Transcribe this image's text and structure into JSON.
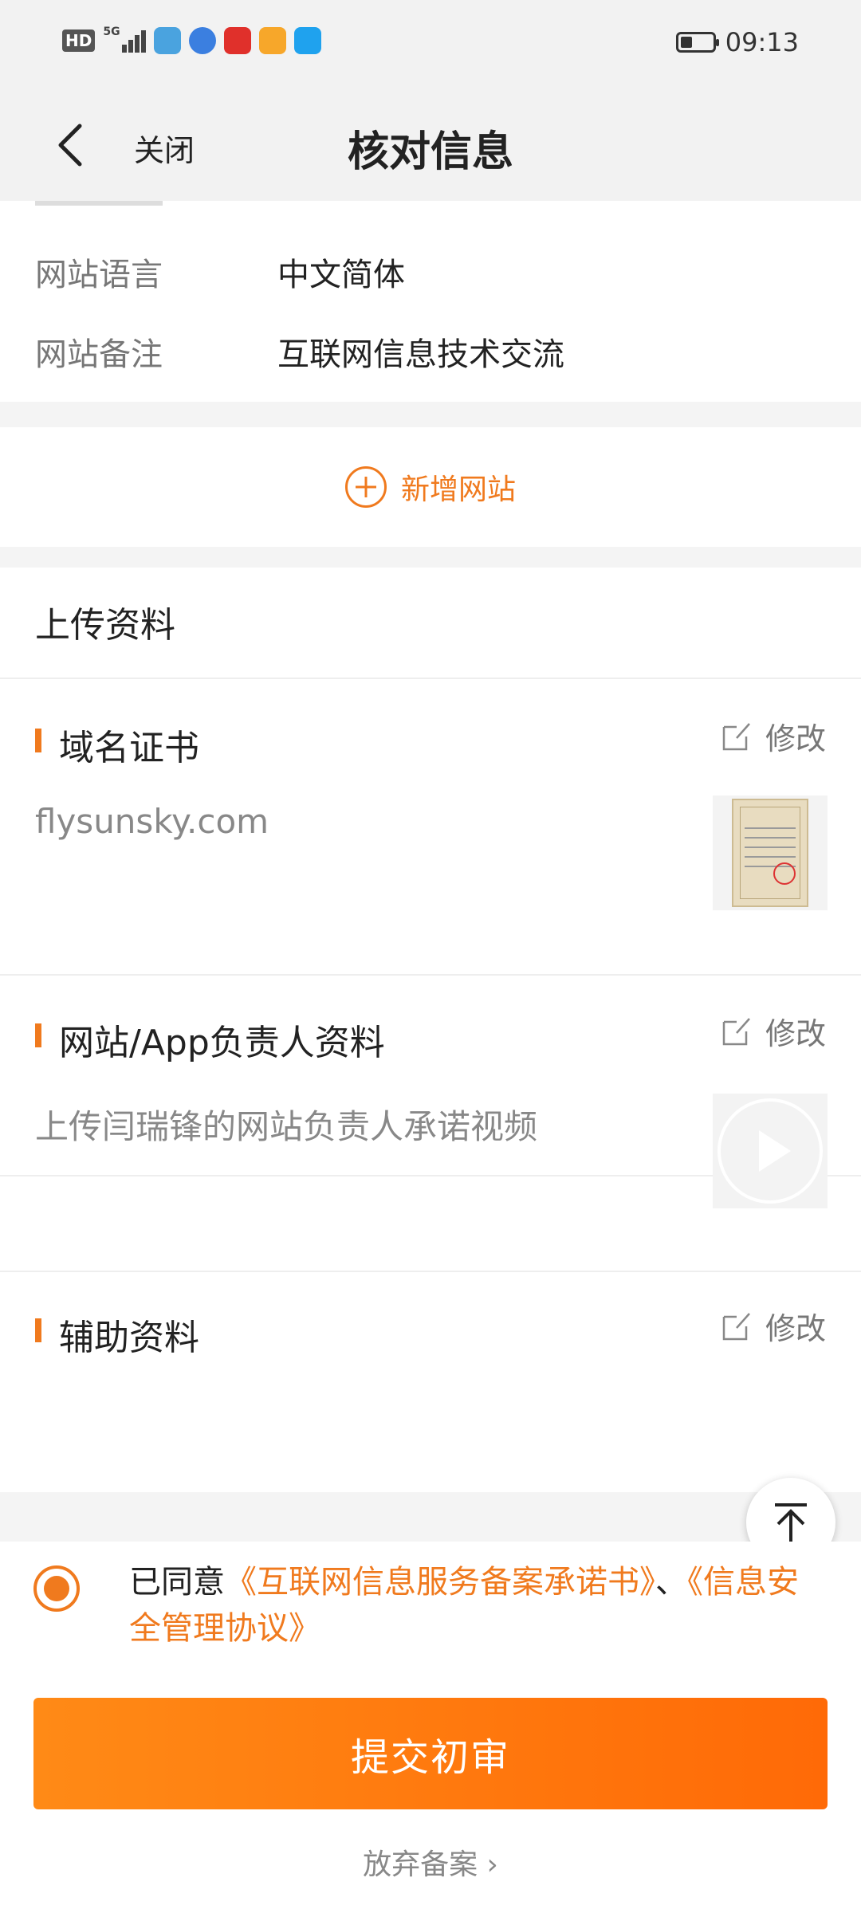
{
  "status_bar": {
    "hd": "HD",
    "net": "5G",
    "time": "09:13",
    "app_icons": [
      "#4aa3df",
      "#3b7fe0",
      "#e0302b",
      "#f7a72a",
      "#1fa2ee"
    ]
  },
  "navbar": {
    "back_icon": "chevron-left-icon",
    "close_label": "关闭",
    "title": "核对信息"
  },
  "site_info": {
    "rows": [
      {
        "key": "网站语言",
        "value": "中文简体"
      },
      {
        "key": "网站备注",
        "value": "互联网信息技术交流"
      }
    ]
  },
  "add_site": {
    "label": "新增网站",
    "icon": "plus-circle-icon"
  },
  "upload": {
    "section_title": "上传资料",
    "edit_label": "修改",
    "blocks": [
      {
        "title": "域名证书",
        "desc": "flysunsky.com",
        "thumb": "certificate-thumbnail"
      },
      {
        "title": "网站/App负责人资料",
        "desc": "上传闫瑞锋的网站负责人承诺视频",
        "thumb": "video-thumbnail"
      },
      {
        "title": "辅助资料",
        "desc": "",
        "thumb": ""
      }
    ]
  },
  "agreement": {
    "prefix": "已同意",
    "link1": "《互联网信息服务备案承诺书》",
    "separator": "、",
    "link2": "《信息安全管理协议》",
    "checked": true
  },
  "submit": {
    "label": "提交初审"
  },
  "abandon": {
    "label": "放弃备案 ›"
  },
  "colors": {
    "accent": "#f07a1e",
    "gradient_start": "#ff8a16",
    "gradient_end": "#ff6a07"
  }
}
